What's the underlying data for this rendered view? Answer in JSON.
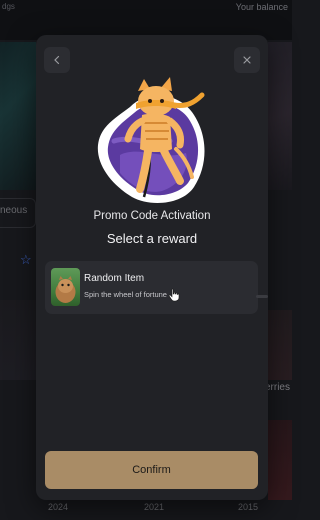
{
  "background": {
    "balance_label": "Your balance",
    "left_top_text": "dgs",
    "left_label": "neous",
    "right_label": "erries",
    "years": [
      "2024",
      "2021",
      "2015"
    ]
  },
  "modal": {
    "back_icon": "chevron-left-icon",
    "close_icon": "close-icon",
    "title": "Promo Code Activation",
    "subtitle": "Select a reward",
    "reward": {
      "name": "Random Item",
      "description": "Spin the wheel of fortune"
    },
    "confirm_label": "Confirm"
  },
  "colors": {
    "modal_bg": "#212226",
    "reward_bg": "#2b2c31",
    "confirm_bg": "#a98c66",
    "accent_purple": "#5b3aa0"
  }
}
